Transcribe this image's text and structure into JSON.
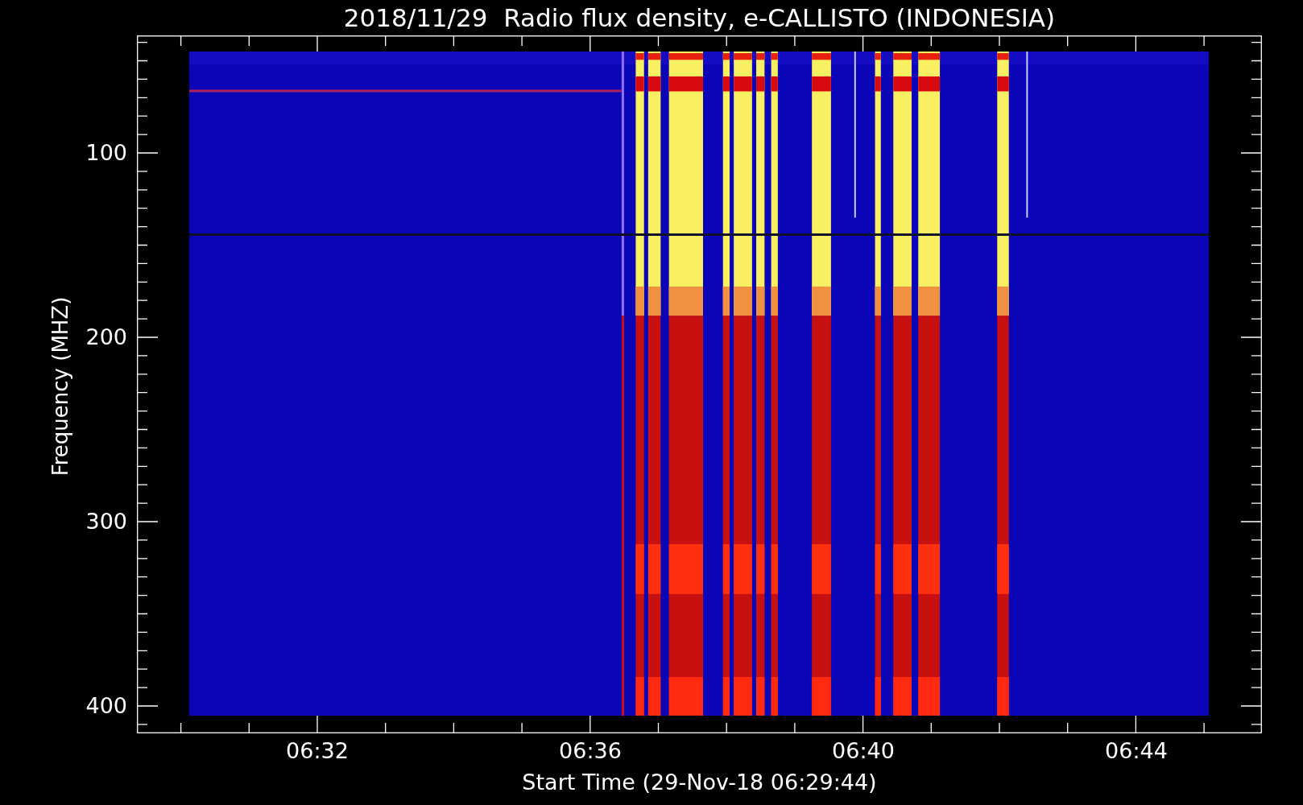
{
  "title": "2018/11/29  Radio flux density, e-CALLISTO (INDONESIA)",
  "y_axis": {
    "label": "Frequency (MHZ)",
    "ticks": [
      "100",
      "200",
      "300",
      "400"
    ]
  },
  "x_axis": {
    "label": "Start Time (29-Nov-18 06:29:44)",
    "ticks": [
      "06:32",
      "06:36",
      "06:40",
      "06:44"
    ]
  }
}
